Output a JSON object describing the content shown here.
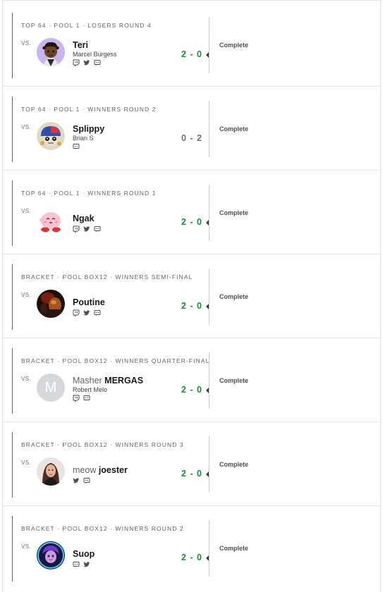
{
  "sets": [
    {
      "phase": "TOP 64 · POOL 1 · LOSERS ROUND 4",
      "vs_label": "VS.",
      "player_prefix": "",
      "player_tag": "Teri",
      "real_name": "Marcel Burgess",
      "socials": [
        "twitch-icon",
        "twitter-icon",
        "discord-icon"
      ],
      "score": "2 - 0",
      "result": "win",
      "status": "Complete",
      "avatar": "cartoon-avatar-purple"
    },
    {
      "phase": "TOP 64 · POOL 1 · WINNERS ROUND 2",
      "vs_label": "VS.",
      "player_prefix": "",
      "player_tag": "Splippy",
      "real_name": "Brian S",
      "socials": [
        "discord-icon"
      ],
      "score": "0 - 2",
      "result": "loss",
      "status": "Complete",
      "avatar": "cartoon-avatar-cap"
    },
    {
      "phase": "TOP 64 · POOL 1 · WINNERS ROUND 1",
      "vs_label": "VS.",
      "player_prefix": "",
      "player_tag": "Ngak",
      "real_name": "",
      "socials": [
        "twitch-icon",
        "twitter-icon",
        "discord-icon"
      ],
      "score": "2 - 0",
      "result": "win",
      "status": "Complete",
      "avatar": "kirby-avatar"
    },
    {
      "phase": "BRACKET · POOL BOX12 · WINNERS SEMI-FINAL",
      "vs_label": "VS.",
      "player_prefix": "",
      "player_tag": "Poutine",
      "real_name": "",
      "socials": [
        "twitch-icon",
        "twitter-icon",
        "discord-icon"
      ],
      "score": "2 - 0",
      "result": "win",
      "status": "Complete",
      "avatar": "photo-avatar-dark"
    },
    {
      "phase": "BRACKET · POOL BOX12 · WINNERS QUARTER-FINAL",
      "vs_label": "VS.",
      "player_prefix": "Masher",
      "player_tag": "MERGAS",
      "real_name": "Robert Melo",
      "socials": [
        "twitch-icon",
        "discord-icon"
      ],
      "score": "2 - 0",
      "result": "win",
      "status": "Complete",
      "avatar": "letter-avatar",
      "avatar_letter": "M"
    },
    {
      "phase": "BRACKET · POOL BOX12 · WINNERS ROUND 3",
      "vs_label": "VS.",
      "player_prefix": "meow",
      "player_tag": "joester",
      "real_name": "",
      "socials": [
        "twitter-icon",
        "discord-icon"
      ],
      "score": "2 - 0",
      "result": "win",
      "status": "Complete",
      "avatar": "photo-avatar-woman"
    },
    {
      "phase": "BRACKET · POOL BOX12 · WINNERS ROUND 2",
      "vs_label": "VS.",
      "player_prefix": "",
      "player_tag": "Suop",
      "real_name": "",
      "socials": [
        "discord-icon",
        "twitter-icon"
      ],
      "score": "2 - 0",
      "result": "win",
      "status": "Complete",
      "avatar": "game-character-avatar"
    }
  ],
  "colors": {
    "win": "#1f8a3b",
    "loss": "#6c7279",
    "border": "#e3e5e8"
  }
}
